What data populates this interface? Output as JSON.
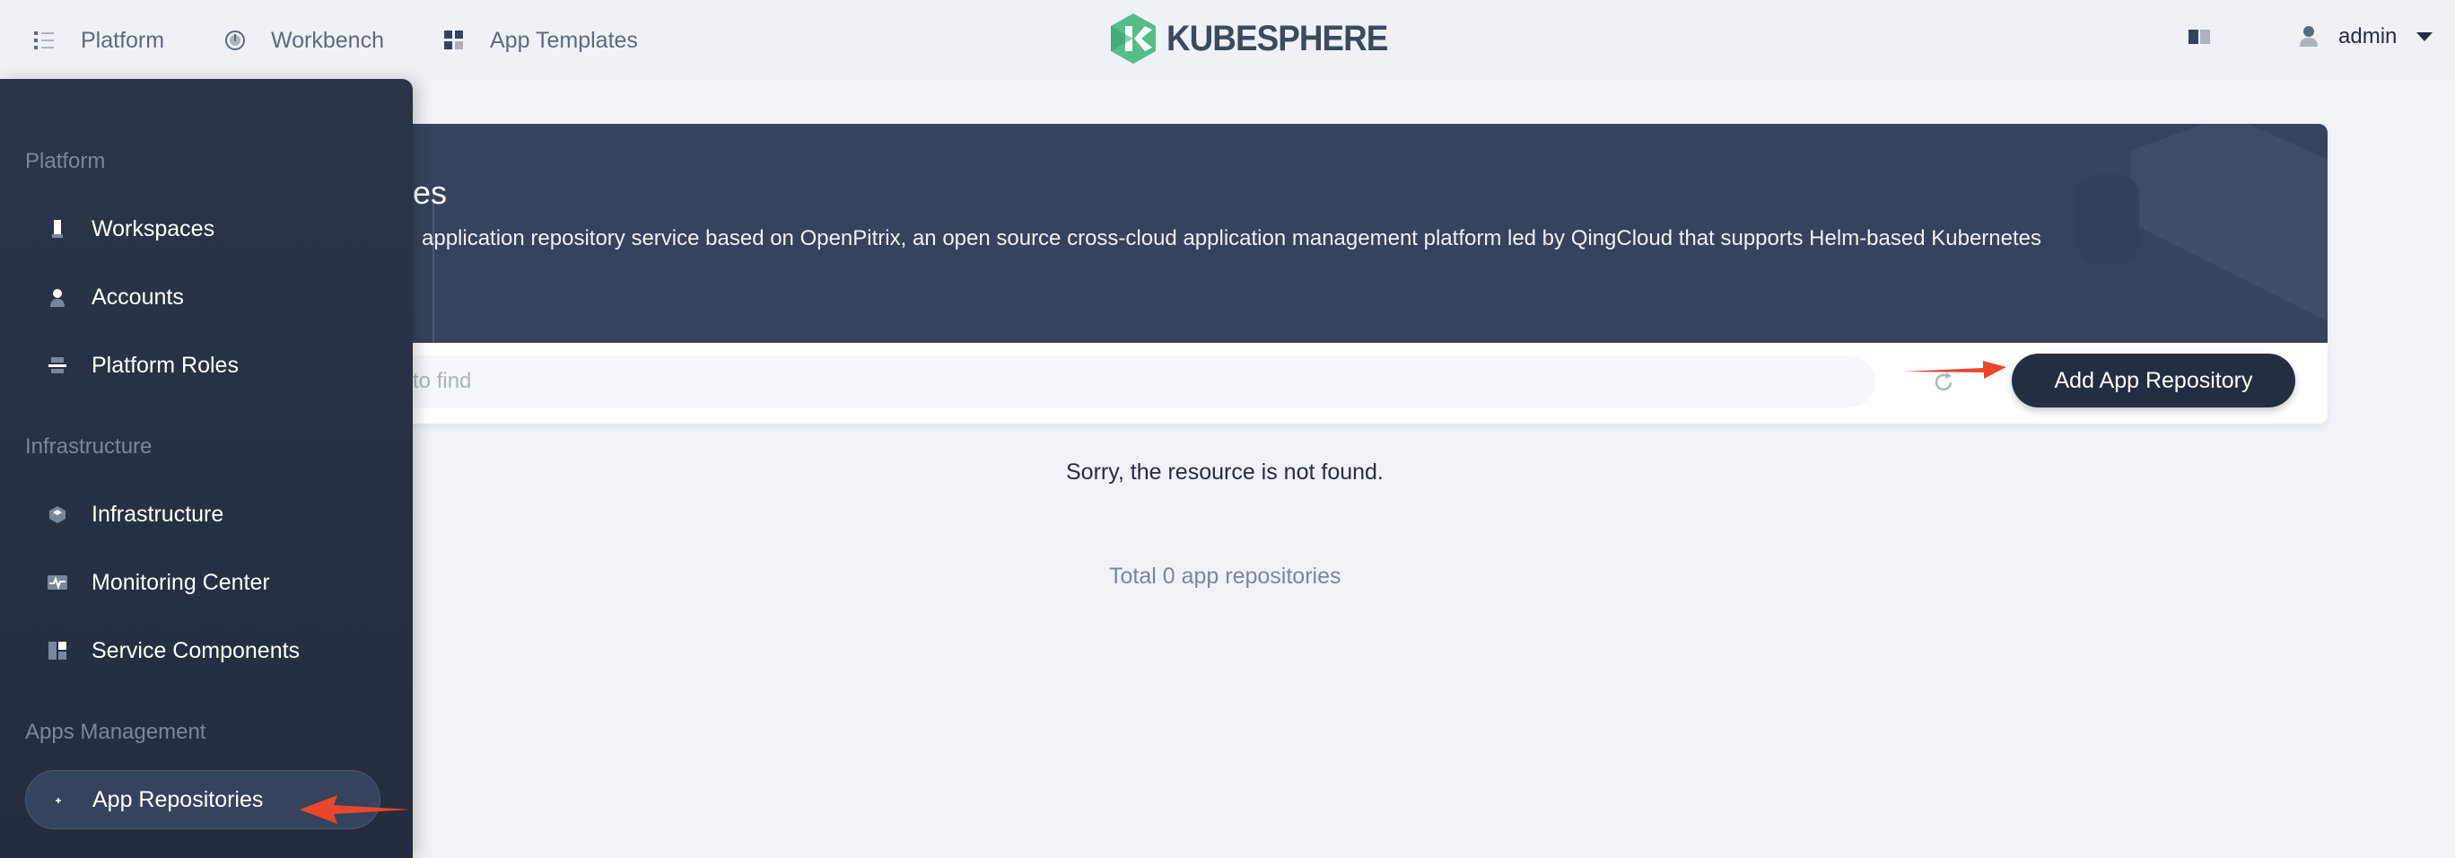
{
  "topnav": {
    "items": [
      {
        "label": "Platform",
        "icon": "list-icon"
      },
      {
        "label": "Workbench",
        "icon": "dashboard-icon"
      },
      {
        "label": "App Templates",
        "icon": "grid-icon"
      }
    ],
    "logo_text": "KUBESPHERE",
    "user": "admin"
  },
  "banner": {
    "title": "ries",
    "description": "application repository service based on OpenPitrix, an open source cross-cloud application management platform led by QingCloud that supports Helm-based Kubernetes"
  },
  "toolbar": {
    "search_placeholder": "e to find",
    "add_button": "Add App Repository"
  },
  "content": {
    "empty_message": "Sorry, the resource is not found.",
    "total": "Total 0 app repositories"
  },
  "sidebar": {
    "groups": [
      {
        "title": "Platform",
        "items": [
          "Workspaces",
          "Accounts",
          "Platform Roles"
        ]
      },
      {
        "title": "Infrastructure",
        "items": [
          "Infrastructure",
          "Monitoring Center",
          "Service Components"
        ]
      },
      {
        "title": "Apps Management",
        "items": [
          "App Repositories"
        ]
      }
    ]
  },
  "colors": {
    "sidebar_bg": "#232d3f",
    "banner_bg": "#36435c",
    "primary_button": "#242e42",
    "logo_green": "#55bc8a",
    "annotation_arrow": "#e8472b"
  }
}
